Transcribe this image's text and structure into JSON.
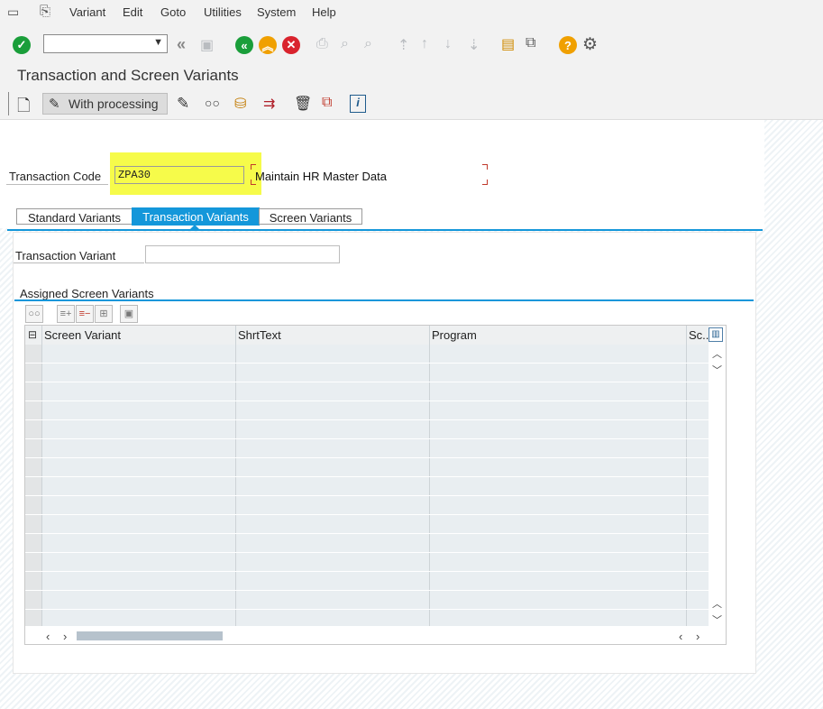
{
  "menu": {
    "items": [
      {
        "label": "Variant"
      },
      {
        "label": "Edit"
      },
      {
        "label": "Goto"
      },
      {
        "label": "Utilities"
      },
      {
        "label": "System"
      },
      {
        "label": "Help"
      }
    ]
  },
  "toolbar": {
    "command_field_value": "",
    "icons": [
      "enter-icon",
      "back-icon",
      "exit-icon",
      "cancel-icon",
      "print-icon",
      "find-icon",
      "find-next-icon",
      "first-page-icon",
      "prev-page-icon",
      "next-page-icon",
      "last-page-icon",
      "create-session-icon",
      "shortcut-icon",
      "help-icon",
      "settings-icon"
    ]
  },
  "title": "Transaction and Screen Variants",
  "app_toolbar": {
    "with_processing_label": "With processing"
  },
  "form": {
    "transaction_code_label": "Transaction Code",
    "transaction_code_value": "ZPA30",
    "transaction_code_description": "Maintain HR Master Data"
  },
  "tabs": [
    {
      "label": "Standard Variants",
      "active": false
    },
    {
      "label": "Transaction Variants",
      "active": true
    },
    {
      "label": "Screen Variants",
      "active": false
    }
  ],
  "tab_page": {
    "transaction_variant_label": "Transaction Variant",
    "transaction_variant_value": "",
    "group_title": "Assigned Screen Variants"
  },
  "table": {
    "columns": [
      "Screen Variant",
      "ShrtText",
      "Program",
      "Sc.."
    ],
    "rows": []
  },
  "colors": {
    "accent": "#1497da",
    "highlight": "#f6fb4a",
    "ok_green": "#1a9e3a",
    "warn_orange": "#f0a000",
    "cancel_red": "#d9232d"
  }
}
